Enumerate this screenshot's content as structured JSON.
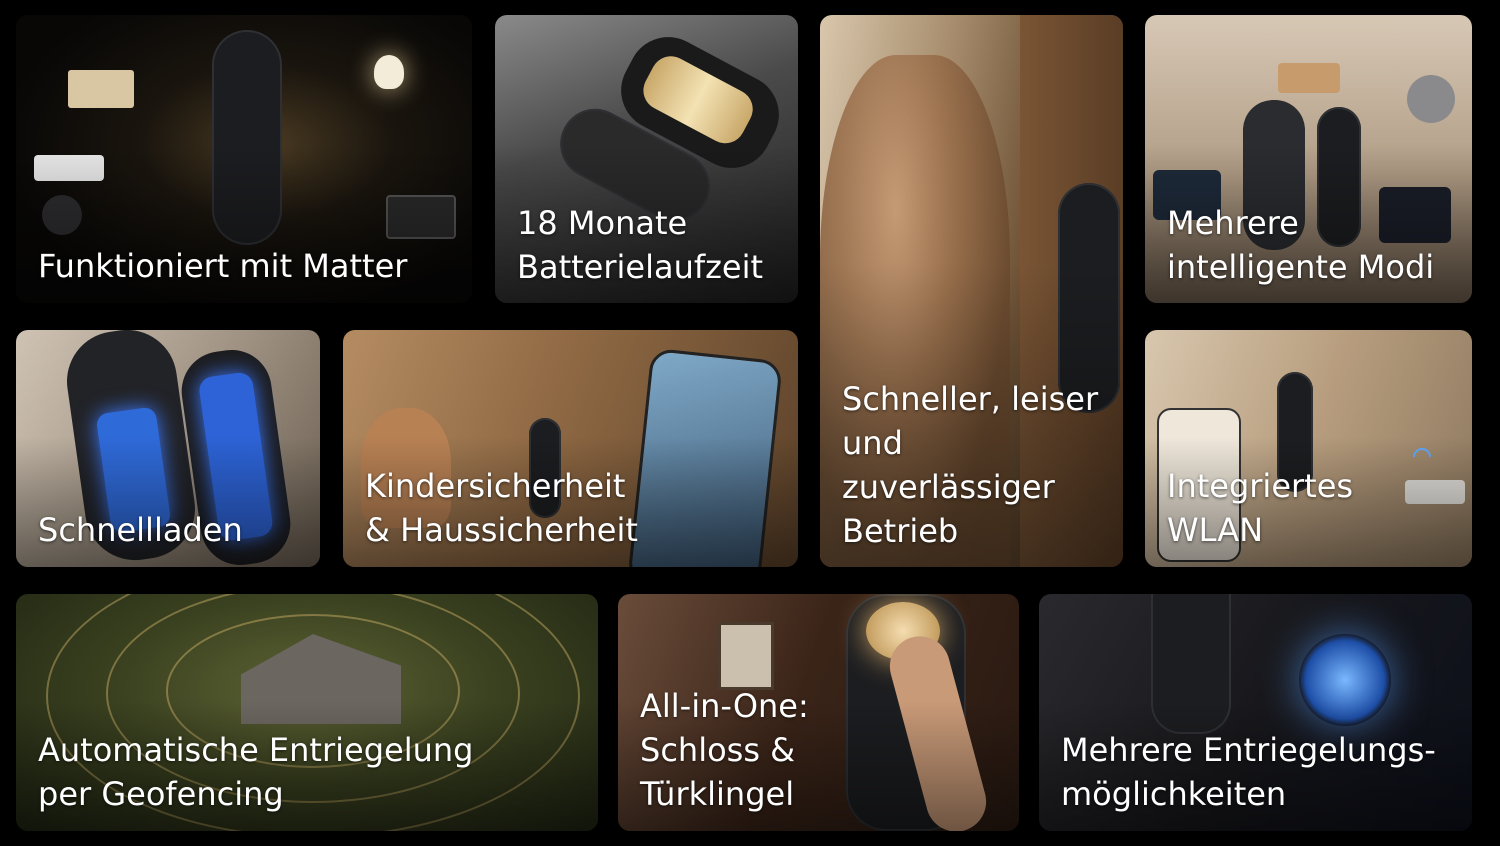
{
  "tiles": [
    {
      "id": "t1",
      "lines": [
        "Funktioniert mit Matter"
      ]
    },
    {
      "id": "t2",
      "lines": [
        "18 Monate",
        "Batterielaufzeit"
      ]
    },
    {
      "id": "t3",
      "lines": [
        "Schneller, leiser",
        "und",
        "zuverlässiger",
        "Betrieb"
      ]
    },
    {
      "id": "t4",
      "lines": [
        "Mehrere",
        "intelligente Modi"
      ]
    },
    {
      "id": "t5",
      "lines": [
        "Schnellladen"
      ]
    },
    {
      "id": "t6",
      "lines": [
        "Kindersicherheit",
        "& Haussicherheit"
      ]
    },
    {
      "id": "t7",
      "lines": [
        "Integriertes",
        "WLAN"
      ]
    },
    {
      "id": "t8",
      "lines": [
        "Automatische Entriegelung",
        "per Geofencing"
      ]
    },
    {
      "id": "t9",
      "lines": [
        "All-in-One:",
        "Schloss &",
        "Türklingel"
      ]
    },
    {
      "id": "t10",
      "lines": [
        "Mehrere Entriegelungs-",
        "möglichkeiten"
      ]
    }
  ]
}
